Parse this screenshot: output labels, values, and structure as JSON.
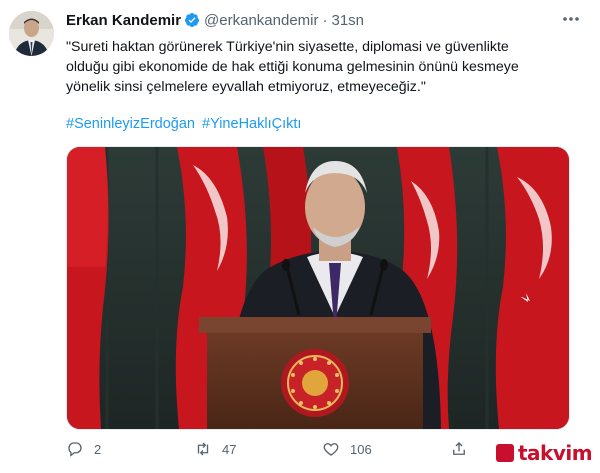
{
  "tweet": {
    "author_name": "Erkan Kandemir",
    "handle": "@erkankandemir",
    "separator": "·",
    "time": "31sn",
    "text_lines": [
      "\"Sureti haktan görünerek Türkiye'nin siyasette, diplomasi ve güvenlikte",
      "olduğu gibi ekonomide de hak ettiği konuma gelmesinin önünü kesmeye",
      "yönelik sinsi çelmelere eyvallah etmiyoruz, etmeyeceğiz.\""
    ],
    "hashtags": [
      "#SeninleyizErdoğan",
      "#YineHaklıÇıktı"
    ],
    "verified_color": "#1d9bf0",
    "link_color": "#1d9bf0"
  },
  "actions": {
    "reply_count": "2",
    "retweet_count": "47",
    "like_count": "106"
  },
  "icons": {
    "verified": "verified-badge-icon",
    "more": "more-options-icon",
    "reply": "reply-icon",
    "retweet": "retweet-icon",
    "like": "heart-icon",
    "share": "share-icon"
  },
  "watermark": {
    "text": "takvim",
    "color": "#c8102e"
  }
}
